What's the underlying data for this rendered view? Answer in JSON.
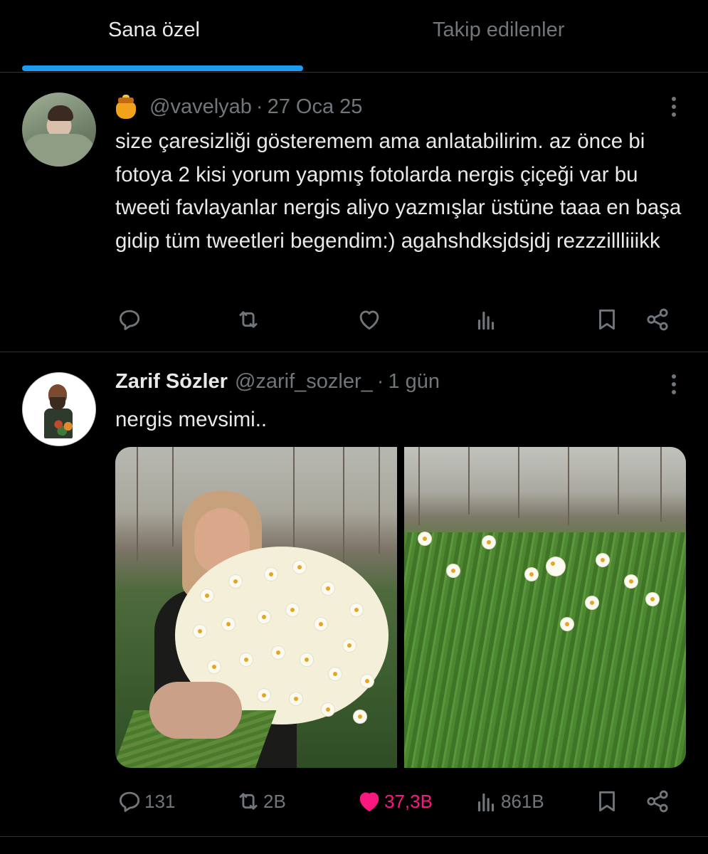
{
  "tabs": [
    {
      "label": "Sana özel",
      "active": true
    },
    {
      "label": "Takip edilenler",
      "active": false
    }
  ],
  "colors": {
    "accent": "#1d9bf0",
    "like_active": "#f91880",
    "secondary_text": "#71767b",
    "background": "#000000"
  },
  "tweets": [
    {
      "author_emoji": "honey-pot-emoji",
      "display_name": "",
      "handle": "@vavelyab",
      "separator": "·",
      "time": "27 Oca 25",
      "text": "size çaresizliği gösteremem ama anlatabilirim. az önce bi fotoya 2 kisi yorum yapmış fotolarda nergis çiçeği var bu tweeti favlayanlar nergis aliyo yazmışlar üstüne taaa en başa gidip tüm tweetleri begendim:) agahshdksjdsjdj rezzzillliiikk",
      "stats": {
        "replies": "",
        "retweets": "",
        "likes": "",
        "views": ""
      },
      "liked": false
    },
    {
      "display_name": "Zarif Sözler",
      "handle": "@zarif_sozler_",
      "separator": "·",
      "time": "1 gün",
      "text": "nergis mevsimi..",
      "stats": {
        "replies": "131",
        "retweets": "2B",
        "likes": "37,3B",
        "views": "861B"
      },
      "liked": true,
      "media": [
        {
          "description_icon": "photo-elderly-woman-with-daffodils"
        },
        {
          "description_icon": "photo-daffodil-field"
        }
      ]
    }
  ],
  "icons": {
    "reply": "reply-icon",
    "retweet": "retweet-icon",
    "like": "heart-icon",
    "views": "views-icon",
    "bookmark": "bookmark-icon",
    "share": "share-icon",
    "more": "more-icon"
  }
}
